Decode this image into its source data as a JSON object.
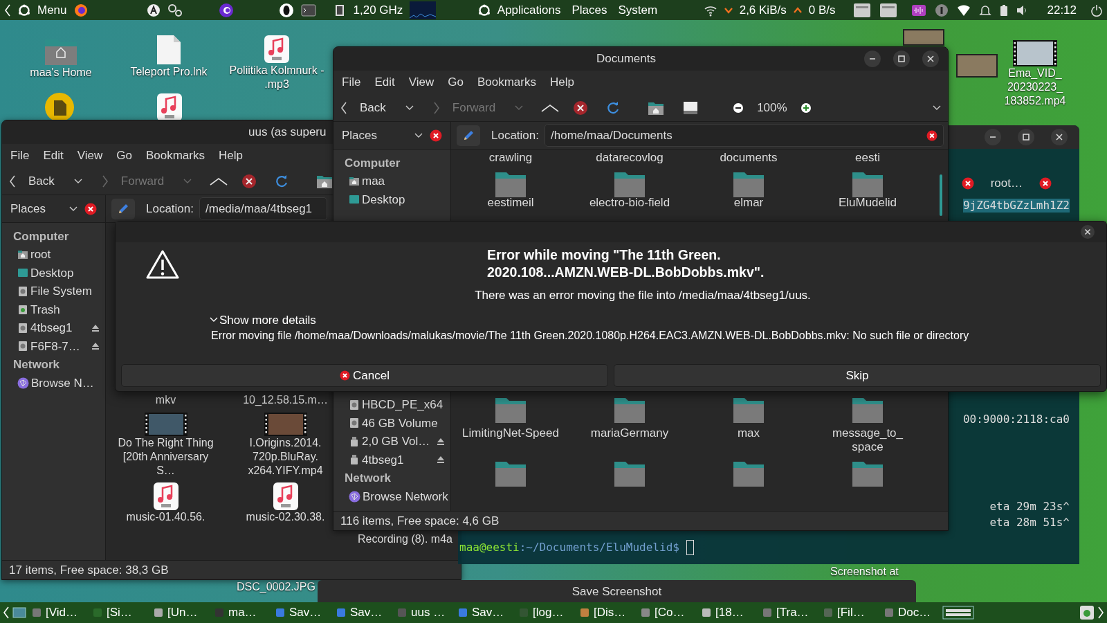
{
  "top_panel": {
    "menu": "Menu",
    "cpu_freq": "1,20 GHz",
    "center_menu": [
      "Applications",
      "Places",
      "System"
    ],
    "net_down": "2,6 KiB/s",
    "net_up": "0 B/s",
    "clock": "22:12"
  },
  "desktop_icons": [
    {
      "kind": "home",
      "label": "maa's Home"
    },
    {
      "kind": "file",
      "label": "Teleport Pro.lnk"
    },
    {
      "kind": "mp3",
      "label": "Poliitika Kolmnurk - .mp3"
    },
    {
      "kind": "app"
    },
    {
      "kind": "mp3"
    },
    {
      "kind": "photo"
    },
    {
      "kind": "video",
      "label": "Ema_VID_ 20230223_ 183852.mp4"
    },
    {
      "kind": "photo"
    },
    {
      "kind": "text",
      "label": "DSC_0002.JPG"
    },
    {
      "kind": "text",
      "label": "Screenshot at"
    }
  ],
  "left_window": {
    "title": "uus (as superu",
    "menu": [
      "File",
      "Edit",
      "View",
      "Go",
      "Bookmarks",
      "Help"
    ],
    "back": "Back",
    "forward": "Forward",
    "places": "Places",
    "location_label": "Location:",
    "location": "/media/maa/4tbseg1",
    "sidebar": [
      {
        "kind": "heading",
        "label": "Computer"
      },
      {
        "kind": "home",
        "label": "root"
      },
      {
        "kind": "desktop",
        "label": "Desktop"
      },
      {
        "kind": "drive",
        "label": "File System"
      },
      {
        "kind": "trash",
        "label": "Trash"
      },
      {
        "kind": "drive",
        "label": "4tbseg1",
        "eject": true
      },
      {
        "kind": "drive",
        "label": "F6F8-7…",
        "eject": true
      },
      {
        "kind": "heading",
        "label": "Network"
      },
      {
        "kind": "network",
        "label": "Browse N…"
      }
    ],
    "files": [
      {
        "kind": "none",
        "label": "mkv"
      },
      {
        "kind": "none",
        "label": "10_12.58.15.m…"
      },
      {
        "kind": "blank"
      },
      {
        "kind": "video",
        "label": "Do The Right Thing [20th Anniversary S…"
      },
      {
        "kind": "video",
        "label": "I.Origins.2014. 720p.BluRay. x264.YIFY.mp4"
      },
      {
        "kind": "blank"
      },
      {
        "kind": "mp3",
        "label": "music-01.40.56."
      },
      {
        "kind": "mp3",
        "label": "music-02.30.38."
      },
      {
        "kind": "none",
        "label": "Recording (8). m4a"
      }
    ],
    "status": "17 items, Free space: 38,3 GB"
  },
  "documents_window": {
    "title": "Documents",
    "menu": [
      "File",
      "Edit",
      "View",
      "Go",
      "Bookmarks",
      "Help"
    ],
    "back": "Back",
    "forward": "Forward",
    "zoom": "100%",
    "places": "Places",
    "location_label": "Location:",
    "location": "/home/maa/Documents",
    "sidebar_top": [
      {
        "kind": "heading",
        "label": "Computer"
      },
      {
        "kind": "home",
        "label": "maa"
      },
      {
        "kind": "desktop",
        "label": "Desktop"
      }
    ],
    "sidebar_bottom": [
      {
        "kind": "drive",
        "label": "HBCD_PE_x64"
      },
      {
        "kind": "drive",
        "label": "46 GB Volume"
      },
      {
        "kind": "usb",
        "label": "2,0 GB Vol…",
        "eject": true
      },
      {
        "kind": "usb",
        "label": "4tbseg1",
        "eject": true
      },
      {
        "kind": "heading",
        "label": "Network"
      },
      {
        "kind": "network",
        "label": "Browse Network"
      }
    ],
    "captions_top": [
      "crawling",
      "datarecovlog",
      "documents",
      "eesti"
    ],
    "folders_top": [
      "eestimeil",
      "electro-bio-field",
      "elmar",
      "EluMudelid"
    ],
    "folders_bottom": [
      "LimitingNet-Speed",
      "mariaGermany",
      "max",
      "message_to_ space"
    ],
    "status": "116 items, Free space: 4,6 GB"
  },
  "terminal": {
    "tab": "root…",
    "lines": [
      "9jZG4tbGZzLmh1Z2",
      "00:9000:2118:ca0",
      "eta 29m 23s^",
      "eta 28m 51s^"
    ],
    "prompt_user": "maa@eesti",
    "prompt_path": ":~/Documents/EluMudelid$"
  },
  "dialog": {
    "title": "Error while moving \"The 11th Green. 2020.108...AMZN.WEB-DL.BobDobbs.mkv\".",
    "message": "There was an error moving the file into /media/maa/4tbseg1/uus.",
    "details_label": "Show more details",
    "expanded": true,
    "details": "Error moving file /home/maa/Downloads/malukas/movie/The 11th Green.2020.1080p.H264.EAC3.AMZN.WEB-DL.BobDobbs.mkv: No such file or directory",
    "buttons": [
      {
        "kind": "cancel",
        "label": "Cancel"
      },
      {
        "kind": "plain",
        "label": "Skip"
      }
    ]
  },
  "screenshot_bar": {
    "title": "Save Screenshot"
  },
  "taskbar": [
    "[Vid…",
    "[Si…",
    "[Un…",
    "ma…",
    "Sav…",
    "Sav…",
    "uus …",
    "Sav…",
    "[log…",
    "[Dis…",
    "[Co…",
    "[18…",
    "[Tra…",
    "[Fil…",
    "Doc…"
  ]
}
